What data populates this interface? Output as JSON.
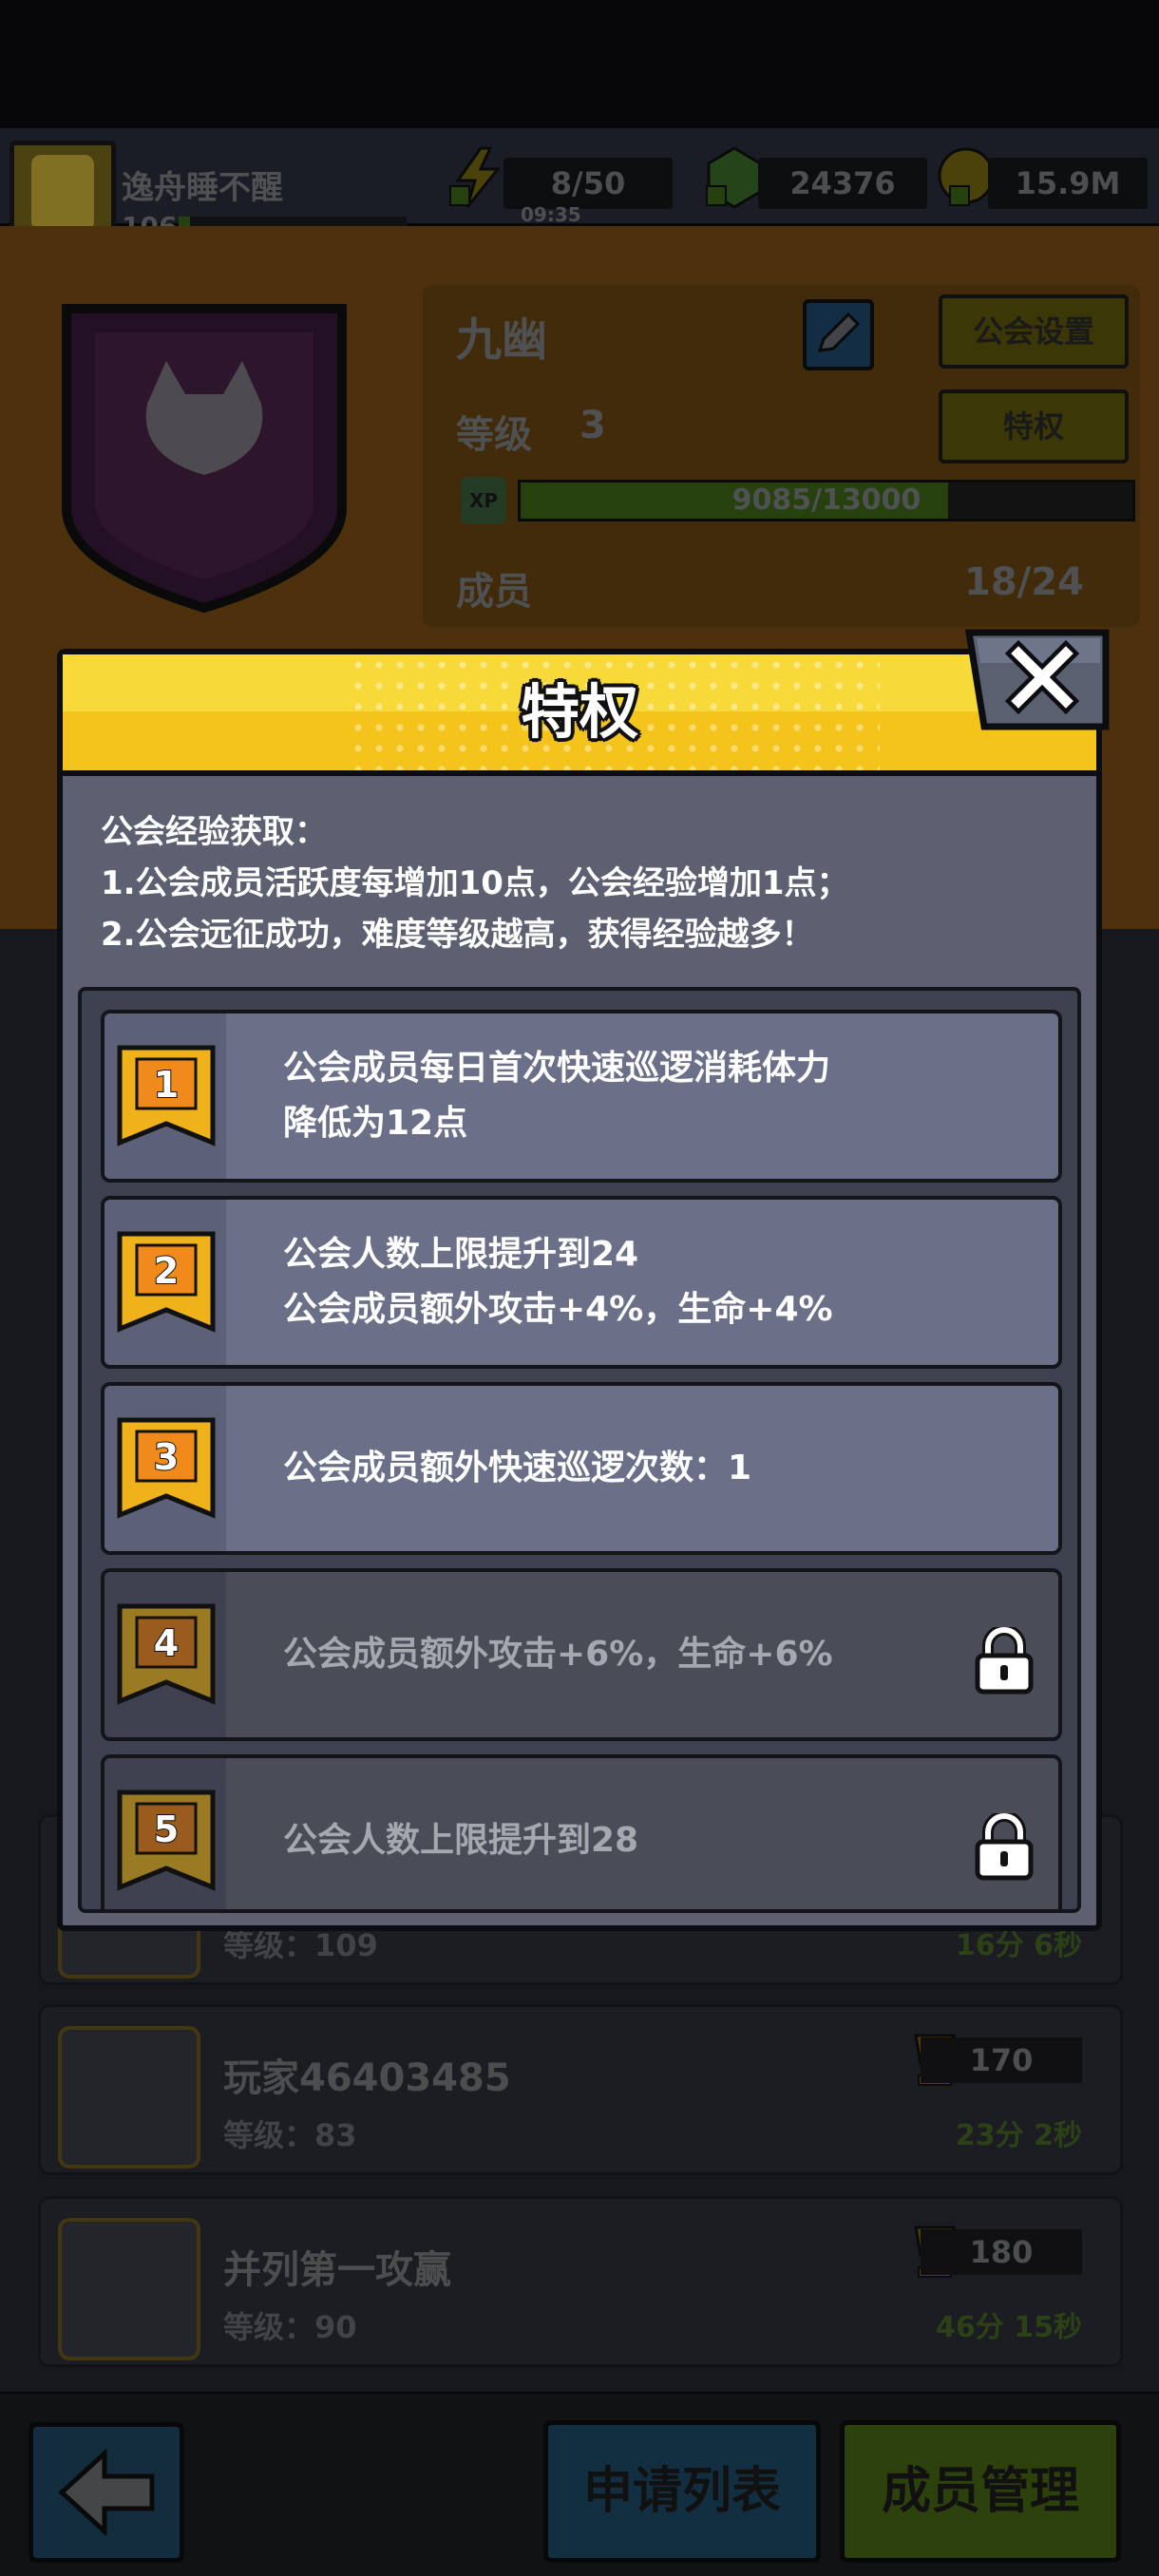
{
  "player": {
    "name": "逸舟睡不醒",
    "level": "106"
  },
  "resources": {
    "energy": "8/50",
    "energy_timer": "09:35",
    "gems": "24376",
    "coins": "15.9M"
  },
  "guild": {
    "name": "九幽",
    "settings_label": "公会设置",
    "privilege_label": "特权",
    "level_label": "等级",
    "level_value": "3",
    "xp_badge": "XP",
    "xp_text": "9085/13000",
    "xp_progress": 0.699,
    "members_label": "成员",
    "members_value": "18/24"
  },
  "members": [
    {
      "name": "",
      "level": "等级：109",
      "score": "",
      "time": "16分 6秒"
    },
    {
      "name": "玩家46403485",
      "level": "等级：83",
      "score": "170",
      "time": "23分 2秒"
    },
    {
      "name": "并列第一攻赢",
      "level": "等级：90",
      "score": "180",
      "time": "46分 15秒"
    }
  ],
  "bottom": {
    "apply_list": "申请列表",
    "member_manage": "成员管理"
  },
  "modal": {
    "title": "特权",
    "description": [
      "公会经验获取：",
      "1.公会成员活跃度每增加10点，公会经验增加1点；",
      "2.公会远征成功，难度等级越高，获得经验越多！"
    ],
    "privileges": [
      {
        "rank": "1",
        "unlocked": true,
        "lines": [
          "公会成员每日首次快速巡逻消耗体力",
          "降低为12点"
        ]
      },
      {
        "rank": "2",
        "unlocked": true,
        "lines": [
          "公会人数上限提升到24",
          "公会成员额外攻击+4%，生命+4%"
        ]
      },
      {
        "rank": "3",
        "unlocked": true,
        "lines": [
          "公会成员额外快速巡逻次数：1"
        ]
      },
      {
        "rank": "4",
        "unlocked": false,
        "lines": [
          "公会成员额外攻击+6%，生命+6%"
        ]
      },
      {
        "rank": "5",
        "unlocked": false,
        "lines": [
          "公会人数上限提升到28"
        ]
      }
    ]
  },
  "colors": {
    "modal_header": "#f5c41a",
    "badge_orange": "#f08a1a",
    "badge_gold": "#f5c41a",
    "unlocked_row": "#6b7088",
    "locked_row": "#4a4c58"
  }
}
